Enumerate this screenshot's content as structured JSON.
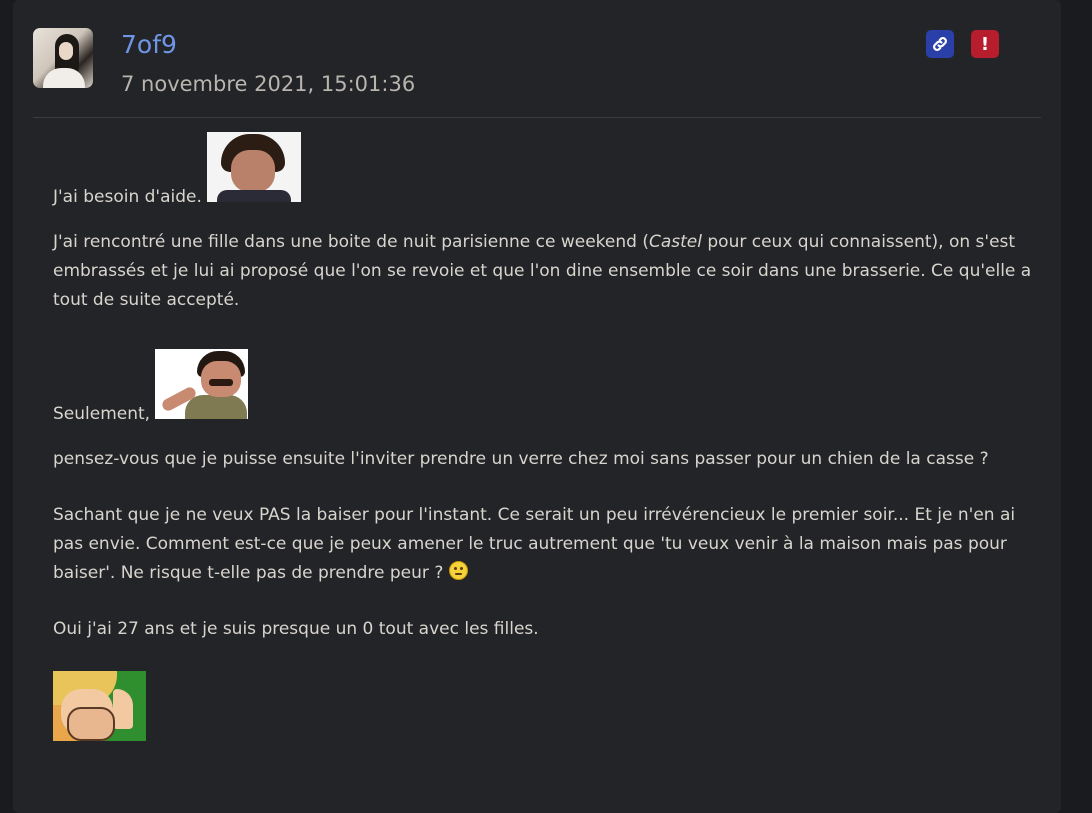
{
  "post": {
    "username": "7of9",
    "timestamp": "7 novembre 2021, 15:01:36",
    "actions": {
      "link_icon": "link-icon",
      "report_icon": "exclamation-icon",
      "report_glyph": "!"
    },
    "body": {
      "p1": "J'ai besoin d'aide.",
      "p2_before": "J'ai rencontré une fille dans une boite de nuit parisienne ce weekend (",
      "p2_em": "Castel",
      "p2_after": " pour ceux qui connaissent), on s'est embrassés et je lui ai proposé que l'on se revoie et que l'on dine ensemble ce soir dans une brasserie. Ce qu'elle a tout de suite accepté.",
      "p3": "Seulement,",
      "p4": "pensez-vous que je puisse ensuite l'inviter prendre un verre chez moi sans passer pour un chien de la casse ?",
      "p5": "Sachant que je ne veux PAS la baiser pour l'instant. Ce serait un peu irrévérencieux le premier soir... Et je n'en ai pas envie. Comment est-ce que je peux amener le truc autrement que 'tu veux venir à la maison mais pas pour baiser'. Ne risque t-elle pas de prendre peur ?",
      "p6": "Oui j'ai 27 ans et je suis presque un 0 tout avec les filles."
    }
  },
  "colors": {
    "background": "#1a1b1e",
    "card": "#232427",
    "username": "#6f95e6",
    "text": "#d8d4ce",
    "link_button": "#2a3fa8",
    "report_button": "#b81d2e"
  }
}
